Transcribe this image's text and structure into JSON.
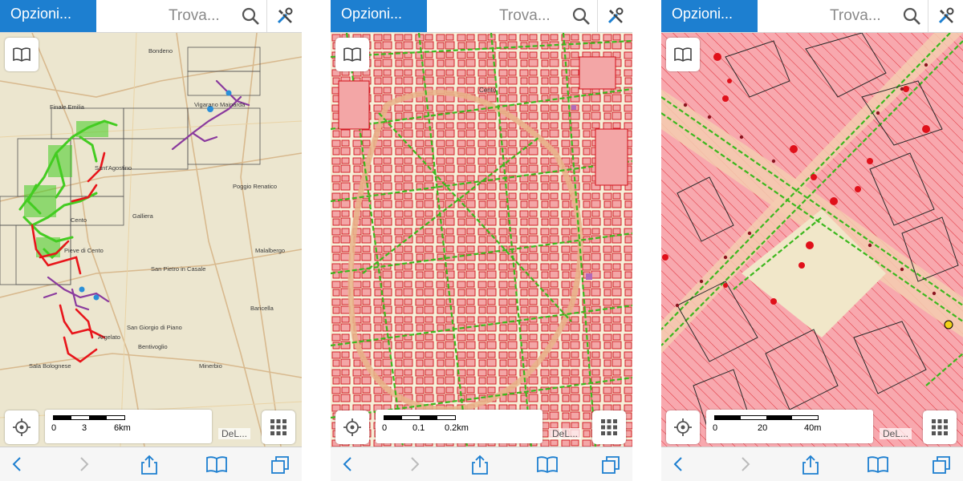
{
  "screens": [
    {
      "topbar": {
        "options_label": "Opzioni...",
        "find_label": "Trova...",
        "search_icon": "search-icon",
        "tools_icon": "tools-icon"
      },
      "map": {
        "place_labels": [
          "Bondeno",
          "Finale Emilia",
          "Vigarano Mainarda",
          "Poggio Renatico",
          "Galliera",
          "Cento",
          "Pieve di Cento",
          "San Pietro in Casale",
          "Malalbergo",
          "Argelato",
          "San Giorgio di Piano",
          "Baricella",
          "Bentivoglio",
          "Sala Bolognese",
          "Minerbio",
          "Sant'Agostino"
        ],
        "colors": {
          "network_green": "#44cc22",
          "network_red": "#e8151b",
          "network_purple": "#8a3a9e",
          "background": "#ece6cf"
        }
      },
      "scale": {
        "ticks": [
          "0",
          "3",
          "6km"
        ]
      },
      "credit": "DeL..."
    },
    {
      "topbar": {
        "options_label": "Opzioni...",
        "find_label": "Trova...",
        "search_icon": "search-icon",
        "tools_icon": "tools-icon"
      },
      "map": {
        "place_labels": [
          "Cento"
        ],
        "colors": {
          "network_green": "#3cb81e",
          "buildings": "#f3a6a6",
          "building_outline": "#d0101a",
          "background": "#f6efd8"
        }
      },
      "scale": {
        "ticks": [
          "0",
          "0.1",
          "0.2km"
        ]
      },
      "credit": "DeL..."
    },
    {
      "topbar": {
        "options_label": "Opzioni...",
        "find_label": "Trova...",
        "search_icon": "search-icon",
        "tools_icon": "tools-icon"
      },
      "map": {
        "colors": {
          "parcels": "#f8a8ae",
          "hatch": "#e0303a",
          "points": "#e0101a",
          "network_green": "#3cb81e",
          "road": "#efe4c4"
        }
      },
      "scale": {
        "ticks": [
          "0",
          "20",
          "40m"
        ]
      },
      "credit": "DeL..."
    }
  ],
  "bottom_nav": [
    "back-icon",
    "forward-icon",
    "share-icon",
    "bookmarks-icon",
    "tabs-icon"
  ]
}
